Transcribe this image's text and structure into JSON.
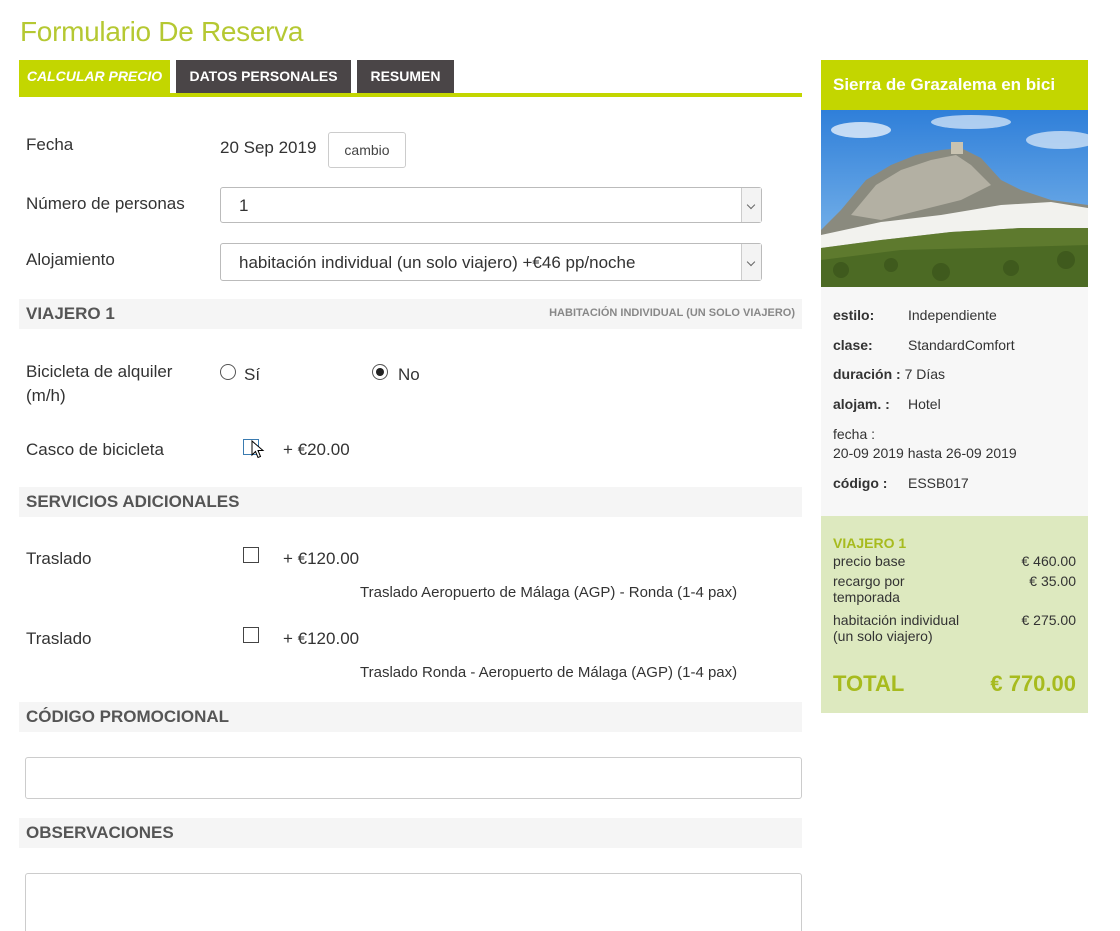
{
  "page": {
    "title": "Formulario De Reserva"
  },
  "tabs": [
    {
      "label": "CALCULAR PRECIO",
      "active": true
    },
    {
      "label": "DATOS PERSONALES",
      "active": false
    },
    {
      "label": "RESUMEN",
      "active": false
    }
  ],
  "form": {
    "fecha": {
      "label": "Fecha",
      "value": "20 Sep 2019",
      "button": "cambio"
    },
    "personas": {
      "label": "Número de personas",
      "value": "1"
    },
    "alojamiento": {
      "label": "Alojamiento",
      "value": "habitación individual (un solo viajero) +€46 pp/noche"
    }
  },
  "viajero": {
    "title": "VIAJERO 1",
    "subtitle": "HABITACIÓN INDIVIDUAL (UN SOLO VIAJERO)",
    "bicicleta": {
      "label": "Bicicleta de alquiler (m/h)",
      "opt_si": "Sí",
      "opt_no": "No",
      "selected": "No"
    },
    "casco": {
      "label": "Casco de bicicleta",
      "price": "+ €20.00"
    }
  },
  "servicios": {
    "title": "SERVICIOS ADICIONALES",
    "items": [
      {
        "label": "Traslado",
        "price": "+ €120.00",
        "desc": "Traslado Aeropuerto de Málaga (AGP) - Ronda (1-4 pax)"
      },
      {
        "label": "Traslado",
        "price": "+ €120.00",
        "desc": "Traslado Ronda - Aeropuerto de Málaga (AGP) (1-4 pax)"
      }
    ]
  },
  "promo": {
    "title": "CÓDIGO PROMOCIONAL",
    "value": ""
  },
  "observaciones": {
    "title": "OBSERVACIONES",
    "value": ""
  },
  "sidebar": {
    "title": "Sierra de Grazalema en bici",
    "info": {
      "estilo": {
        "key": "estilo:",
        "value": "Independiente"
      },
      "clase": {
        "key": "clase:",
        "value": "StandardComfort"
      },
      "duracion": {
        "key": "duración :",
        "value": "7 Días"
      },
      "alojam": {
        "key": "alojam. :",
        "value": "Hotel"
      },
      "fecha": {
        "key": "fecha :",
        "value": "20-09 2019 hasta 26-09 2019"
      },
      "codigo": {
        "key": "código :",
        "value": "ESSB017"
      }
    },
    "pricing": {
      "title": "VIAJERO 1",
      "rows": [
        {
          "label": "precio base",
          "amount": "€ 460.00"
        },
        {
          "label": "recargo por temporada",
          "amount": "€ 35.00"
        },
        {
          "label": "habitación individual (un solo viajero)",
          "amount": "€ 275.00"
        }
      ],
      "total_label": "TOTAL",
      "total_amount": "€ 770.00"
    }
  },
  "colors": {
    "accent": "#c3d600",
    "tab_dark": "#4a4547",
    "price_bg": "#dde9bf",
    "title_green": "#b5c832"
  }
}
